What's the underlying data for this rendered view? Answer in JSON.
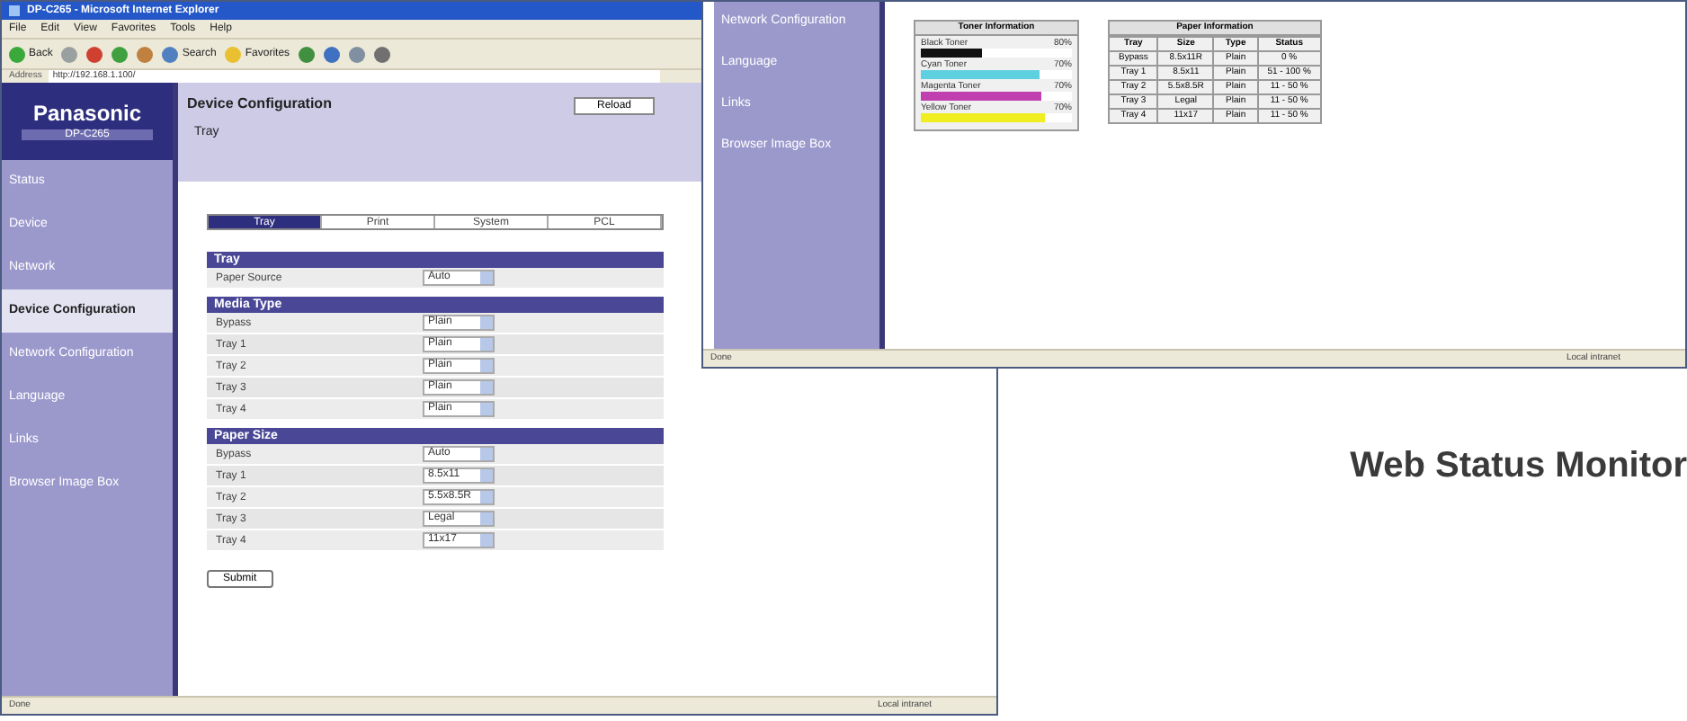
{
  "main_window": {
    "title": "DP-C265 - Microsoft Internet Explorer",
    "menu": [
      "File",
      "Edit",
      "View",
      "Favorites",
      "Tools",
      "Help"
    ],
    "toolbar": [
      "Back",
      "Search",
      "Favorites"
    ],
    "address_label": "Address",
    "address": "http://192.168.1.100/",
    "brand": "Panasonic",
    "model": "DP-C265",
    "sidebar": [
      {
        "label": "Status",
        "selected": false
      },
      {
        "label": "Device",
        "selected": false
      },
      {
        "label": "Network",
        "selected": false
      },
      {
        "label": "Device Configuration",
        "selected": true
      },
      {
        "label": "Network Configuration",
        "selected": false
      },
      {
        "label": "Language",
        "selected": false
      },
      {
        "label": "Links",
        "selected": false
      },
      {
        "label": "Browser Image Box",
        "selected": false
      }
    ],
    "page_title": "Device Configuration",
    "page_subtitle": "Tray",
    "reload_button": "Reload",
    "tabs": [
      {
        "label": "Tray",
        "selected": true
      },
      {
        "label": "Print",
        "selected": false
      },
      {
        "label": "System",
        "selected": false
      },
      {
        "label": "PCL",
        "selected": false
      }
    ],
    "sections": [
      {
        "title": "Tray",
        "rows": [
          {
            "label": "Paper Source",
            "value": "Auto"
          }
        ]
      },
      {
        "title": "Media Type",
        "rows": [
          {
            "label": "Bypass",
            "value": "Plain"
          },
          {
            "label": "Tray 1",
            "value": "Plain"
          },
          {
            "label": "Tray 2",
            "value": "Plain"
          },
          {
            "label": "Tray 3",
            "value": "Plain"
          },
          {
            "label": "Tray 4",
            "value": "Plain"
          }
        ]
      },
      {
        "title": "Paper Size",
        "rows": [
          {
            "label": "Bypass",
            "value": "Auto"
          },
          {
            "label": "Tray 1",
            "value": "8.5x11"
          },
          {
            "label": "Tray 2",
            "value": "5.5x8.5R"
          },
          {
            "label": "Tray 3",
            "value": "Legal"
          },
          {
            "label": "Tray 4",
            "value": "11x17"
          }
        ]
      }
    ],
    "submit_button": "Submit",
    "status_left": "Done",
    "status_right": "Local intranet"
  },
  "status_window": {
    "sidebar": [
      {
        "label": "Network Configuration",
        "selected": false
      },
      {
        "label": "Language",
        "selected": false
      },
      {
        "label": "Links",
        "selected": false
      },
      {
        "label": "Browser Image Box",
        "selected": false
      }
    ],
    "toner": {
      "title": "Toner Information",
      "items": [
        {
          "name": "Black Toner",
          "reading": "80%",
          "level": 0.4,
          "color": "#111111"
        },
        {
          "name": "Cyan Toner",
          "reading": "70%",
          "level": 0.78,
          "color": "#5fd0e0"
        },
        {
          "name": "Magenta Toner",
          "reading": "70%",
          "level": 0.8,
          "color": "#c040b0"
        },
        {
          "name": "Yellow Toner",
          "reading": "70%",
          "level": 0.82,
          "color": "#f0ee20"
        }
      ]
    },
    "paper": {
      "title": "Paper Information",
      "columns": [
        "Tray",
        "Size",
        "Type",
        "Status"
      ],
      "rows": [
        [
          "Bypass",
          "8.5x11R",
          "Plain",
          "0 %"
        ],
        [
          "Tray 1",
          "8.5x11",
          "Plain",
          "51 - 100 %"
        ],
        [
          "Tray 2",
          "5.5x8.5R",
          "Plain",
          "11 - 50 %"
        ],
        [
          "Tray 3",
          "Legal",
          "Plain",
          "11 - 50 %"
        ],
        [
          "Tray 4",
          "11x17",
          "Plain",
          "11 - 50 %"
        ]
      ]
    },
    "status_left": "Done",
    "status_right": "Local intranet"
  },
  "caption": "Web Status Monitor"
}
